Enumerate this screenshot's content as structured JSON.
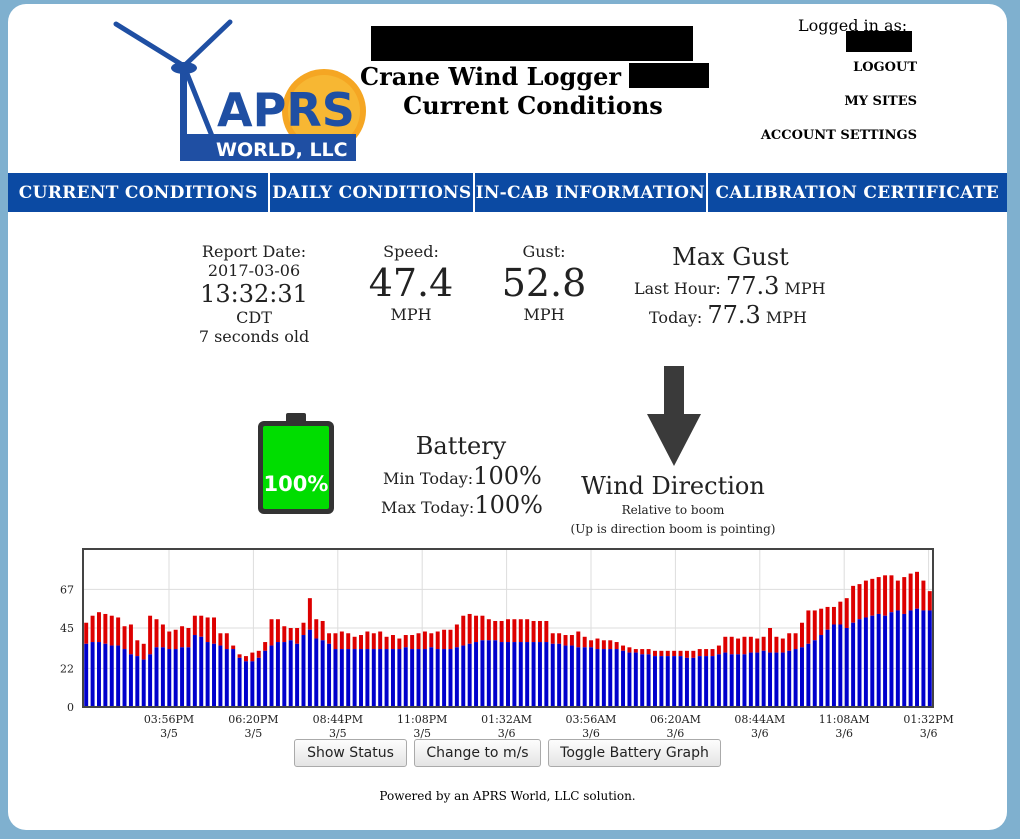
{
  "header": {
    "title_line1": "Crane Wind Logger",
    "title_line2": "Current Conditions",
    "logged_in_label": "Logged in as:",
    "links": [
      "LOGOUT",
      "MY SITES",
      "ACCOUNT SETTINGS"
    ],
    "logo": {
      "top_text": "APRS",
      "bottom_text": "WORLD, LLC",
      "colors": {
        "blue": "#1f4fa3",
        "sun": "#f5a623"
      }
    }
  },
  "nav": {
    "items": [
      "CURRENT CONDITIONS",
      "DAILY CONDITIONS",
      "IN-CAB INFORMATION",
      "CALIBRATION CERTIFICATE"
    ],
    "color": "#0b4aa3"
  },
  "report": {
    "label": "Report Date:",
    "date": "2017-03-06",
    "time": "13:32:31",
    "tz": "CDT",
    "age": "7 seconds old"
  },
  "speed": {
    "label": "Speed:",
    "value": "47.4",
    "unit": "MPH"
  },
  "gust": {
    "label": "Gust:",
    "value": "52.8",
    "unit": "MPH"
  },
  "max_gust": {
    "title": "Max Gust",
    "last_hour_label": "Last Hour:",
    "last_hour_value": "77.3",
    "today_label": "Today:",
    "today_value": "77.3",
    "unit": "MPH"
  },
  "battery": {
    "title": "Battery",
    "level_text": "100%",
    "level": 1.0,
    "min_label": "Min Today:",
    "min_value": "100%",
    "max_label": "Max Today:",
    "max_value": "100%",
    "color": "#00dd00"
  },
  "wind": {
    "title": "Wind Direction",
    "sub1": "Relative to boom",
    "sub2": "(Up is direction boom is pointing)",
    "direction_deg": 180
  },
  "chart_data": {
    "type": "bar",
    "stacked": true,
    "yticks": [
      0,
      22,
      45,
      67
    ],
    "ylim": [
      0,
      90
    ],
    "xlabels": [
      {
        "time": "03:56PM",
        "date": "3/5"
      },
      {
        "time": "06:20PM",
        "date": "3/5"
      },
      {
        "time": "08:44PM",
        "date": "3/5"
      },
      {
        "time": "11:08PM",
        "date": "3/5"
      },
      {
        "time": "01:32AM",
        "date": "3/6"
      },
      {
        "time": "03:56AM",
        "date": "3/6"
      },
      {
        "time": "06:20AM",
        "date": "3/6"
      },
      {
        "time": "08:44AM",
        "date": "3/6"
      },
      {
        "time": "11:08AM",
        "date": "3/6"
      },
      {
        "time": "01:32PM",
        "date": "3/6"
      }
    ],
    "series": [
      {
        "color": "#0000cc",
        "values": [
          36,
          37,
          37,
          36,
          35,
          35,
          33,
          30,
          29,
          27,
          30,
          34,
          34,
          33,
          33,
          34,
          34,
          41,
          40,
          37,
          36,
          35,
          33,
          33,
          28,
          26,
          26,
          28,
          32,
          35,
          37,
          37,
          38,
          36,
          41,
          44,
          39,
          38,
          36,
          33,
          33,
          33,
          33,
          33,
          33,
          33,
          33,
          33,
          33,
          33,
          34,
          33,
          33,
          33,
          34,
          33,
          33,
          33,
          34,
          35,
          36,
          37,
          38,
          38,
          38,
          37,
          37,
          37,
          37,
          37,
          37,
          37,
          37,
          36,
          36,
          35,
          35,
          34,
          34,
          34,
          33,
          33,
          33,
          33,
          32,
          31,
          31,
          30,
          30,
          29,
          29,
          29,
          29,
          29,
          28,
          28,
          29,
          29,
          29,
          30,
          31,
          30,
          30,
          30,
          31,
          31,
          32,
          31,
          31,
          31,
          32,
          33,
          34,
          36,
          38,
          41,
          44,
          47,
          47,
          45,
          48,
          50,
          51,
          52,
          53,
          52,
          54,
          55,
          53,
          55,
          56,
          55,
          55
        ],
        "name": ""
      },
      {
        "color": "#dd0000",
        "values": [
          48,
          52,
          54,
          53,
          52,
          51,
          46,
          47,
          38,
          36,
          52,
          50,
          47,
          43,
          44,
          46,
          45,
          52,
          52,
          51,
          51,
          42,
          42,
          35,
          30,
          29,
          31,
          32,
          37,
          50,
          50,
          46,
          45,
          45,
          48,
          62,
          50,
          49,
          42,
          42,
          43,
          42,
          40,
          41,
          43,
          42,
          43,
          40,
          41,
          39,
          41,
          41,
          42,
          43,
          42,
          43,
          44,
          44,
          47,
          52,
          53,
          52,
          52,
          50,
          49,
          49,
          50,
          50,
          50,
          50,
          49,
          49,
          49,
          42,
          42,
          41,
          41,
          43,
          40,
          38,
          39,
          38,
          38,
          37,
          35,
          34,
          33,
          33,
          33,
          32,
          32,
          32,
          32,
          32,
          32,
          32,
          33,
          33,
          33,
          35,
          40,
          40,
          39,
          40,
          40,
          39,
          40,
          45,
          40,
          39,
          42,
          42,
          48,
          55,
          55,
          56,
          57,
          57,
          60,
          62,
          69,
          70,
          72,
          73,
          74,
          75,
          75,
          72,
          74,
          76,
          77,
          72,
          66
        ],
        "name": ""
      }
    ]
  },
  "buttons": [
    "Show Status",
    "Change to m/s",
    "Toggle Battery Graph"
  ],
  "footer": "Powered by an APRS World, LLC solution."
}
